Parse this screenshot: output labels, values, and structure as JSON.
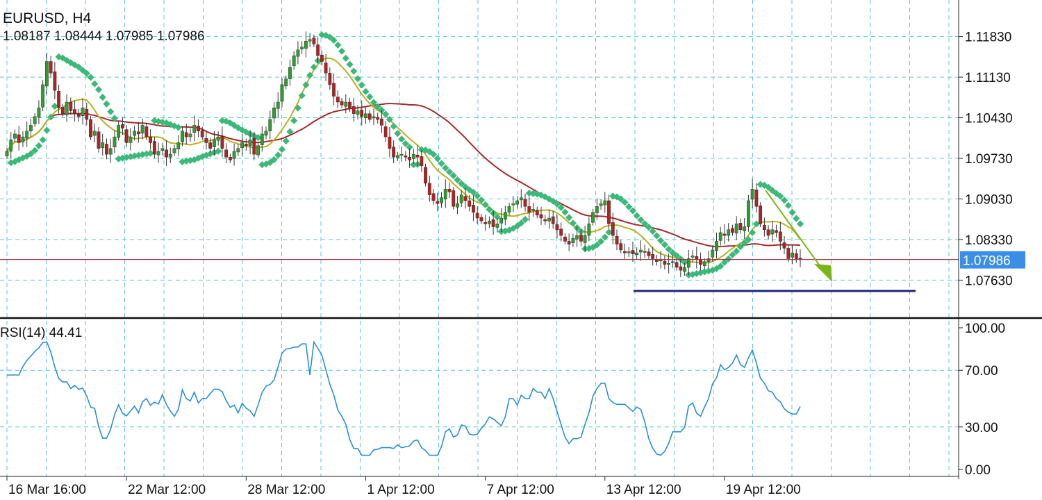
{
  "header": {
    "symbol": "EURUSD, H4",
    "ohlc": "1.08187 1.08444 1.07985 1.07986"
  },
  "rsi_label": "RSI(14) 44.41",
  "colors": {
    "grid": "#5fc6d6",
    "bull": "#2e9e2e",
    "bear": "#b22222",
    "wick": "#333333",
    "ma_slow": "#a52a2a",
    "ma_fast": "#b8b020",
    "sar": "#3cb878",
    "rsi": "#2a8fd0",
    "support": "#1a237e",
    "arrow": "#7cb518",
    "price_line": "#a0304a",
    "price_tag": "#3a8ee6"
  },
  "chart_data": [
    {
      "type": "candlestick",
      "title": "EURUSD, H4",
      "ylim": [
        1.07,
        1.124
      ],
      "y_ticks": [
        "1.11830",
        "1.11130",
        "1.10430",
        "1.09730",
        "1.09030",
        "1.08330",
        "1.07630"
      ],
      "y_tick_values": [
        1.1183,
        1.1113,
        1.1043,
        1.0973,
        1.0903,
        1.0833,
        1.0763
      ],
      "x_ticks": [
        "16 Mar 16:00",
        "22 Mar 12:00",
        "28 Mar 12:00",
        "1 Apr 12:00",
        "7 Apr 12:00",
        "13 Apr 12:00",
        "19 Apr 12:00"
      ],
      "x_tick_index": [
        0,
        30,
        60,
        90,
        120,
        150,
        180
      ],
      "last_price": "1.07986",
      "last_price_value": 1.07986,
      "close": [
        1.0985,
        1.1005,
        1.1015,
        1.1,
        1.101,
        1.102,
        1.103,
        1.1045,
        1.106,
        1.11,
        1.114,
        1.112,
        1.109,
        1.106,
        1.105,
        1.107,
        1.1055,
        1.105,
        1.1045,
        1.106,
        1.104,
        1.101,
        1.102,
        1.099,
        1.1,
        1.098,
        1.099,
        1.101,
        1.103,
        1.1025,
        1.1,
        1.101,
        1.102,
        1.1015,
        1.103,
        1.101,
        1.1,
        1.098,
        1.0985,
        1.099,
        1.0975,
        1.098,
        1.099,
        1.1,
        1.102,
        1.101,
        1.1015,
        1.103,
        1.102,
        1.101,
        1.1,
        1.099,
        1.1005,
        1.101,
        1.099,
        1.0975,
        1.097,
        1.0985,
        1.099,
        1.1,
        1.0995,
        1.1005,
        1.098,
        1.0995,
        1.1015,
        1.102,
        1.104,
        1.106,
        1.107,
        1.11,
        1.111,
        1.113,
        1.115,
        1.116,
        1.1165,
        1.1175,
        1.1178,
        1.117,
        1.115,
        1.114,
        1.112,
        1.11,
        1.108,
        1.107,
        1.1065,
        1.107,
        1.106,
        1.105,
        1.1055,
        1.1045,
        1.105,
        1.104,
        1.1045,
        1.104,
        1.103,
        1.101,
        1.099,
        1.0975,
        1.0978,
        1.098,
        1.0975,
        1.097,
        1.098,
        1.0975,
        1.096,
        1.093,
        1.091,
        1.09,
        1.0895,
        1.0905,
        1.092,
        1.0915,
        1.089,
        1.0895,
        1.091,
        1.09,
        1.089,
        1.088,
        1.087,
        1.0865,
        1.086,
        1.0865,
        1.0855,
        1.086,
        1.087,
        1.088,
        1.089,
        1.0895,
        1.09,
        1.0905,
        1.089,
        1.088,
        1.0885,
        1.0875,
        1.087,
        1.0865,
        1.087,
        1.086,
        1.085,
        1.084,
        1.083,
        1.0825,
        1.0835,
        1.084,
        1.083,
        1.084,
        1.086,
        1.088,
        1.089,
        1.0895,
        1.09,
        1.086,
        1.084,
        1.0825,
        1.0815,
        1.081,
        1.0812,
        1.0808,
        1.081,
        1.0815,
        1.0812,
        1.0805,
        1.08,
        1.0795,
        1.0798,
        1.079,
        1.0792,
        1.0795,
        1.0785,
        1.078,
        1.0785,
        1.08,
        1.0805,
        1.0798,
        1.079,
        1.0795,
        1.08,
        1.0815,
        1.083,
        1.0845,
        1.084,
        1.085,
        1.0845,
        1.086,
        1.085,
        1.0855,
        1.09,
        1.092,
        1.089,
        1.086,
        1.085,
        1.084,
        1.085,
        1.0845,
        1.083,
        1.0818,
        1.08,
        1.081,
        1.08,
        1.0799
      ],
      "rsi": {
        "ylim": [
          0,
          100
        ],
        "y_ticks": [
          "100.00",
          "70.00",
          "30.00",
          "0.00"
        ],
        "y_tick_values": [
          100,
          70,
          30,
          0
        ],
        "last_value": 44.41
      }
    }
  ]
}
